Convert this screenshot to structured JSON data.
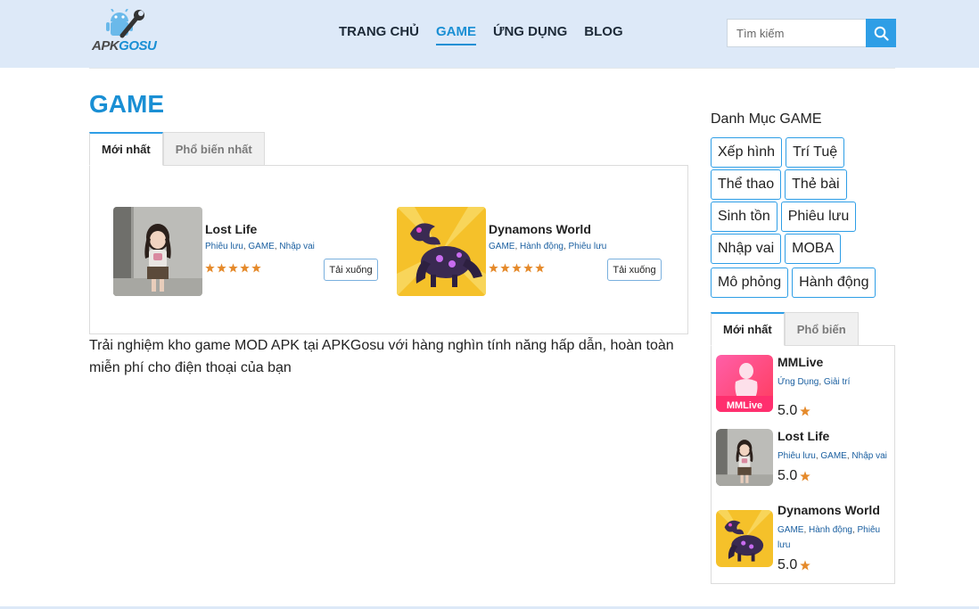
{
  "header": {
    "logo_part1": "APK",
    "logo_part2": "GOSU",
    "nav": [
      {
        "label": "TRANG CHỦ",
        "active": false
      },
      {
        "label": "GAME",
        "active": true
      },
      {
        "label": "ỨNG DỤNG",
        "active": false
      },
      {
        "label": "BLOG",
        "active": false
      }
    ],
    "search_placeholder": "Tìm kiếm",
    "search_icon": "search-icon"
  },
  "main": {
    "title": "GAME",
    "tabs": [
      {
        "label": "Mới nhất",
        "active": true
      },
      {
        "label": "Phổ biến nhất",
        "active": false
      }
    ],
    "cards": [
      {
        "name": "Lost Life",
        "categories": [
          "Phiêu lưu",
          "GAME",
          "Nhập vai"
        ],
        "stars": 5,
        "download_label": "Tải xuống"
      },
      {
        "name": "Dynamons World",
        "categories": [
          "GAME",
          "Hành động",
          "Phiêu lưu"
        ],
        "stars": 5,
        "download_label": "Tải xuống"
      }
    ],
    "description": "Trải nghiệm kho game MOD APK tại APKGosu với hàng nghìn tính năng hấp dẫn, hoàn toàn miễn phí cho điện thoại của bạn"
  },
  "sidebar": {
    "category_title": "Danh Mục GAME",
    "categories": [
      "Xếp hình",
      "Trí Tuệ",
      "Thể thao",
      "Thẻ bài",
      "Sinh tồn",
      "Phiêu lưu",
      "Nhập vai",
      "MOBA",
      "Mô phỏng",
      "Hành động"
    ],
    "tabs": [
      {
        "label": "Mới nhất",
        "active": true
      },
      {
        "label": "Phổ biến",
        "active": false
      }
    ],
    "items": [
      {
        "name": "MMLive",
        "categories": [
          "Ứng Dụng",
          "Giải trí"
        ],
        "rating": "5.0",
        "icon_text": "MMLive"
      },
      {
        "name": "Lost Life",
        "categories": [
          "Phiêu lưu",
          "GAME",
          "Nhập vai"
        ],
        "rating": "5.0"
      },
      {
        "name": "Dynamons World",
        "categories": [
          "GAME",
          "Hành động",
          "Phiêu lưu"
        ],
        "rating": "5.0"
      }
    ]
  },
  "colors": {
    "accent": "#1a8fd4",
    "header_bg": "#dde9f8",
    "star": "#e58a2b",
    "link": "#1a5fa0"
  }
}
